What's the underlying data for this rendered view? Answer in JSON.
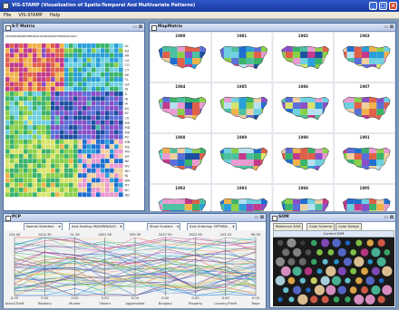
{
  "window": {
    "title": "VIS-STAMP (Visualization of Spatio-Temporal And Multivariate Patterns)",
    "controls": [
      "_",
      "□",
      "×"
    ]
  },
  "menu": [
    "File",
    "VIS-STAMP",
    "Help"
  ],
  "st_matrix": {
    "title": "S-T Matrix",
    "time_axis": "8182838485868788899091929394959697989900010203",
    "row_labels": [
      "AL",
      "AZ",
      "AR",
      "CA",
      "CO",
      "CT",
      "DE",
      "FL",
      "GA",
      "ID",
      "IL",
      "IN",
      "IA",
      "KS",
      "KY",
      "LA",
      "ME",
      "MD",
      "MA",
      "MI",
      "MN",
      "MS",
      "MO",
      "MT",
      "NE",
      "NV",
      "NH",
      "NJ",
      "NM",
      "NY",
      "NC",
      "ND"
    ],
    "rows": 32,
    "cols": 26
  },
  "map_matrix": {
    "title": "MapMatrix",
    "years": [
      "1980",
      "1981",
      "1982",
      "1983",
      "1984",
      "1985",
      "1986",
      "1987",
      "1988",
      "1989",
      "1990",
      "1991",
      "1992",
      "1993",
      "1994",
      "1995"
    ]
  },
  "pcp": {
    "title": "PCP",
    "controls": [
      "Normal Selection",
      "Axis Scaling: MAX/MIN/AVG",
      "Show Clusters",
      "Axis Ordering: OPTIMAL"
    ],
    "top_values": [
      "104.40",
      "1024.30",
      "91.36",
      "2821.59",
      "299.90",
      "2437.90",
      "1622.90",
      "103.33",
      "98.90"
    ],
    "bottom_values": [
      "0.00",
      "0.00",
      "0.00",
      "0.00",
      "0.00",
      "0.00",
      "0.00",
      "0.00",
      "0.00"
    ],
    "axis_labels": [
      "Arson/Theft",
      "Robbery",
      "Murder",
      "Violent",
      "Aggravated",
      "Burglary",
      "Property",
      "Larceny/Theft",
      "Rape"
    ]
  },
  "som": {
    "title": "SOM",
    "tabs": [
      "Reference SOM",
      "Color Scheme",
      "Color Design"
    ],
    "subheader": "Current SOM"
  },
  "colors": {
    "title_bg": "#1f45b4",
    "panel_border": "#4a6fa8",
    "som_bg": "#1a1a1a"
  }
}
